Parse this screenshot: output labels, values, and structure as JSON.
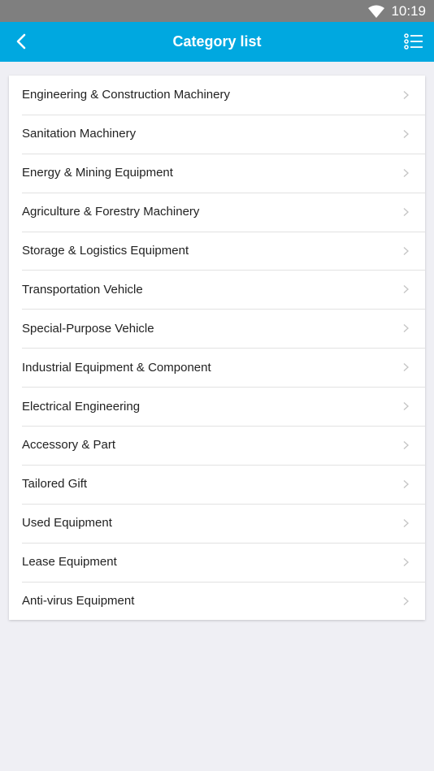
{
  "status_bar": {
    "time": "10:19",
    "icons": [
      "wifi-icon"
    ]
  },
  "app_bar": {
    "title": "Category list",
    "back_icon": "chevron-left-icon",
    "menu_icon": "list-menu-icon",
    "color": "#00a8e0"
  },
  "categories": [
    {
      "label": "Engineering & Construction Machinery"
    },
    {
      "label": "Sanitation Machinery"
    },
    {
      "label": "Energy & Mining Equipment"
    },
    {
      "label": "Agriculture & Forestry Machinery"
    },
    {
      "label": "Storage & Logistics Equipment"
    },
    {
      "label": "Transportation Vehicle"
    },
    {
      "label": "Special-Purpose Vehicle"
    },
    {
      "label": "Industrial Equipment & Component"
    },
    {
      "label": "Electrical Engineering"
    },
    {
      "label": "Accessory & Part"
    },
    {
      "label": "Tailored Gift"
    },
    {
      "label": "Used Equipment"
    },
    {
      "label": "Lease Equipment"
    },
    {
      "label": "Anti-virus Equipment"
    }
  ]
}
